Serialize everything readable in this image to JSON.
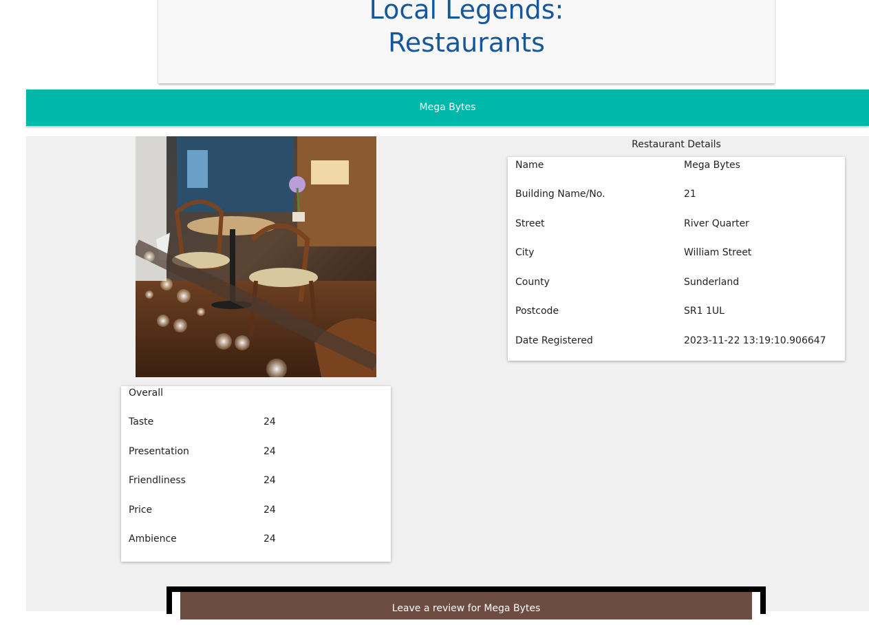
{
  "header": {
    "title_line1": "Local Legends:",
    "title_line2": "Restaurants"
  },
  "restaurant_bar": {
    "label": "Mega Bytes"
  },
  "photo": {
    "alt": "restaurant-photo"
  },
  "scores": {
    "heading": "Overall",
    "rows": [
      {
        "label": "Taste",
        "value": "24"
      },
      {
        "label": "Presentation",
        "value": "24"
      },
      {
        "label": "Friendliness",
        "value": "24"
      },
      {
        "label": "Price",
        "value": "24"
      },
      {
        "label": "Ambience",
        "value": "24"
      }
    ]
  },
  "details": {
    "title": "Restaurant Details",
    "rows": [
      {
        "label": "Name",
        "value": "Mega Bytes"
      },
      {
        "label": "Building Name/No.",
        "value": "21"
      },
      {
        "label": "Street",
        "value": "River Quarter"
      },
      {
        "label": "City",
        "value": "William Street"
      },
      {
        "label": "County",
        "value": "Sunderland"
      },
      {
        "label": "Postcode",
        "value": "SR1 1UL"
      },
      {
        "label": "Date Registered",
        "value": "2023-11-22 13:19:10.906647"
      }
    ]
  },
  "review": {
    "label": "Leave a review for Mega Bytes"
  },
  "colors": {
    "title_blue": "#15579a",
    "teal_bar": "#00b8a9",
    "review_brown": "#6d4c41",
    "content_bg": "#f0f0f0"
  }
}
